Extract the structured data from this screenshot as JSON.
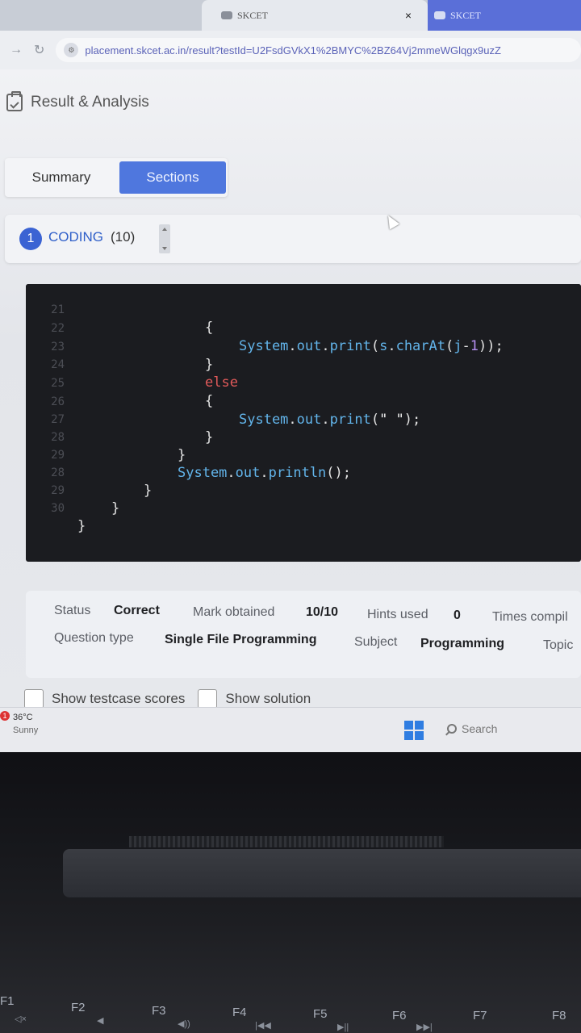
{
  "browser": {
    "active_tab_title": "SKCET",
    "other_tab_title": "SKCET",
    "close_glyph": "×",
    "url": "placement.skcet.ac.in/result?testId=U2FsdGVkX1%2BMYC%2BZ64Vj2mmeWGlqgx9uzZ"
  },
  "page": {
    "title": "Result & Analysis",
    "tabs": [
      {
        "label": "Summary",
        "active": false
      },
      {
        "label": "Sections",
        "active": true
      }
    ],
    "section": {
      "number": "1",
      "name": "CODING",
      "count": "(10)"
    }
  },
  "code": {
    "lines": [
      {
        "num": "21",
        "text": "{"
      },
      {
        "num": "22",
        "text": "System.out.print(s.charAt(j-1));"
      },
      {
        "num": "23",
        "text": "}"
      },
      {
        "num": "24",
        "text": "else"
      },
      {
        "num": "25",
        "text": "{"
      },
      {
        "num": "26",
        "text": "System.out.print(\" \");"
      },
      {
        "num": "27",
        "text": "}"
      },
      {
        "num": "28",
        "text": "}"
      },
      {
        "num": "29",
        "text": "System.out.println();"
      },
      {
        "num": "28",
        "text": "}"
      },
      {
        "num": "29",
        "text": "}"
      },
      {
        "num": "30",
        "text": "}"
      }
    ],
    "colors": {
      "keyword": "#e25a5a",
      "object": "#62b4ea",
      "number": "#b48ef0"
    }
  },
  "result": {
    "status_label": "Status",
    "status_value": "Correct",
    "mark_label": "Mark obtained",
    "mark_value": "10/10",
    "hints_label": "Hints used",
    "hints_value": "0",
    "times_label": "Times compil",
    "qtype_label": "Question type",
    "qtype_value": "Single File Programming",
    "subject_label": "Subject",
    "subject_value": "Programming",
    "topic_label": "Topic",
    "show_scores_label": "Show testcase scores",
    "show_solution_label": "Show solution"
  },
  "taskbar": {
    "weather_badge": "1",
    "temperature": "36°C",
    "condition": "Sunny",
    "search_label": "Search"
  },
  "keyboard": {
    "keys": [
      "F1",
      "F2",
      "F3",
      "F4",
      "F5",
      "F6",
      "F7",
      "F8"
    ]
  }
}
